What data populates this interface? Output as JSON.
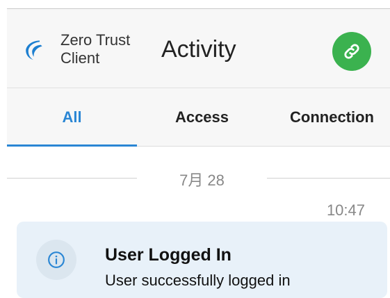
{
  "header": {
    "brand_line1": "Zero Trust",
    "brand_line2": "Client",
    "title": "Activity",
    "link_icon": "link-icon",
    "accent_green": "#3bb24f"
  },
  "tabs": [
    {
      "label": "All",
      "active": true
    },
    {
      "label": "Access",
      "active": false
    },
    {
      "label": "Connection",
      "active": false
    }
  ],
  "accent_blue": "#2a86d4",
  "activity": {
    "date": "7月 28",
    "time": "10:47",
    "items": [
      {
        "icon": "info-icon",
        "title": "User Logged In",
        "subtitle": "User successfully logged in"
      }
    ]
  }
}
